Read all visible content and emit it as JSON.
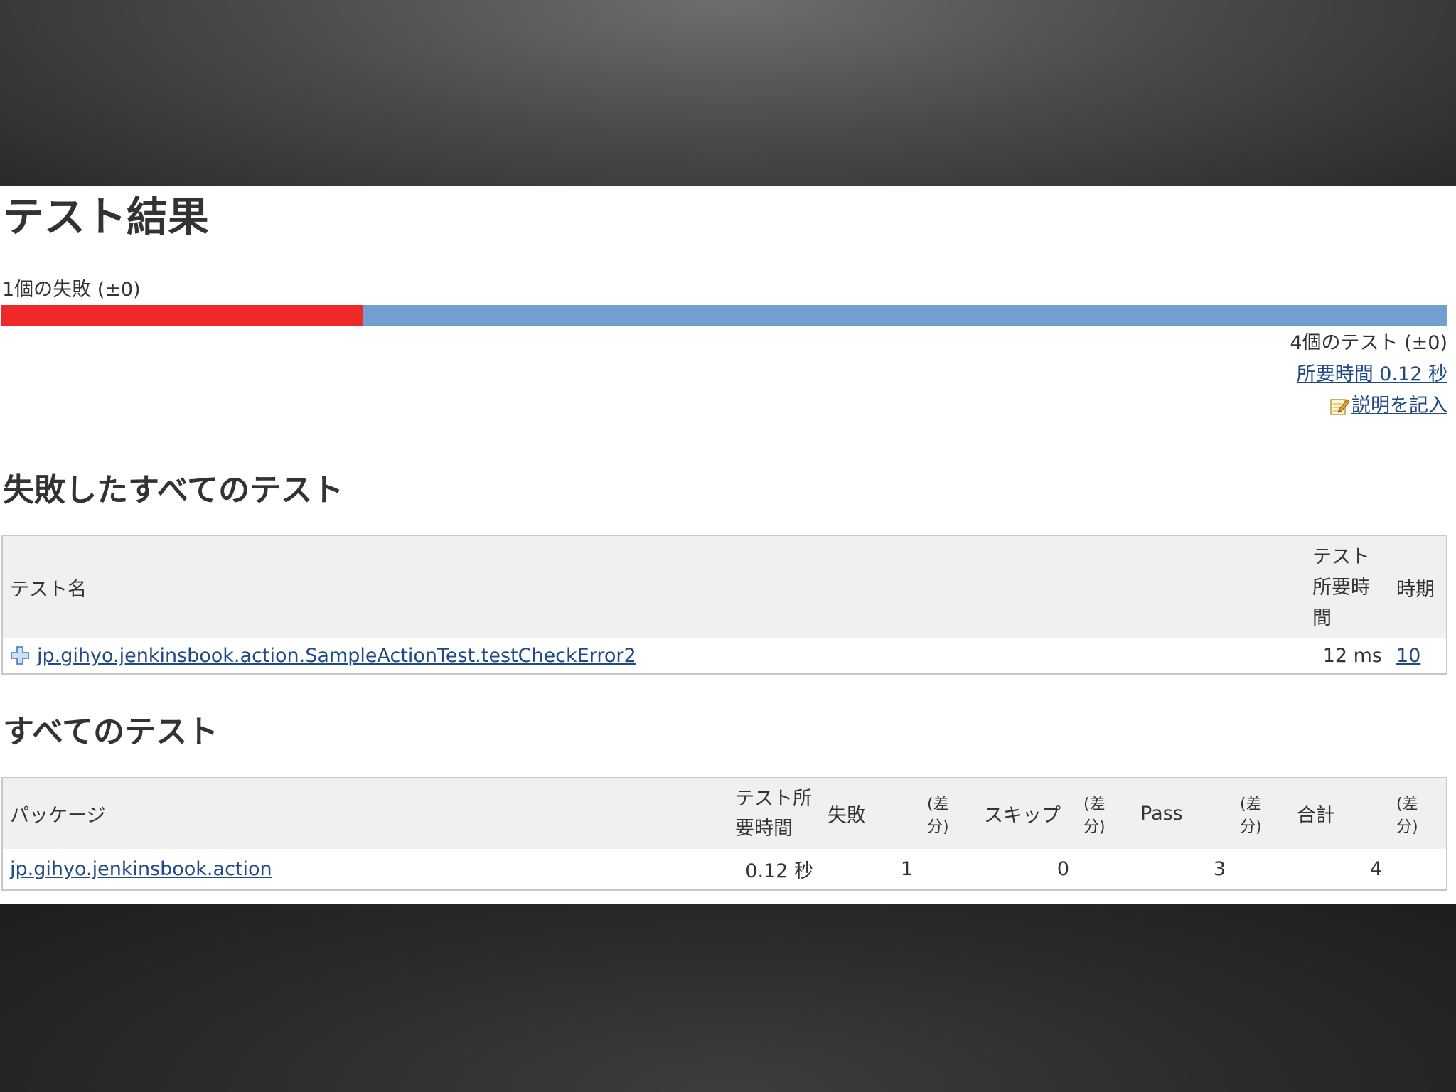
{
  "page": {
    "title": "テスト結果",
    "fail_summary": "1個の失敗 (±0)",
    "progress": {
      "fail_fraction": 0.25,
      "fail_color": "#ef2929",
      "pass_color": "#729fcf"
    },
    "test_count": "4個のテスト (±0)",
    "duration_link": "所要時間 0.12 秒",
    "add_description": "説明を記入"
  },
  "failed": {
    "title": "失敗したすべてのテスト",
    "headers": {
      "name": "テスト名",
      "duration": "テスト所要時間",
      "age": "時期"
    },
    "rows": [
      {
        "name": "jp.gihyo.jenkinsbook.action.SampleActionTest.testCheckError2",
        "duration": "12 ms",
        "age": "10"
      }
    ]
  },
  "all": {
    "title": "すべてのテスト",
    "headers": {
      "package": "パッケージ",
      "duration": "テスト所要時間",
      "fail": "失敗",
      "diff1": "(差分)",
      "skip": "スキップ",
      "diff2": "(差分)",
      "pass": "Pass",
      "diff3": "(差分)",
      "total": "合計",
      "diff4": "(差分)"
    },
    "rows": [
      {
        "package": "jp.gihyo.jenkinsbook.action",
        "duration": "0.12 秒",
        "fail": "1",
        "skip": "0",
        "pass": "3",
        "total": "4"
      }
    ]
  }
}
